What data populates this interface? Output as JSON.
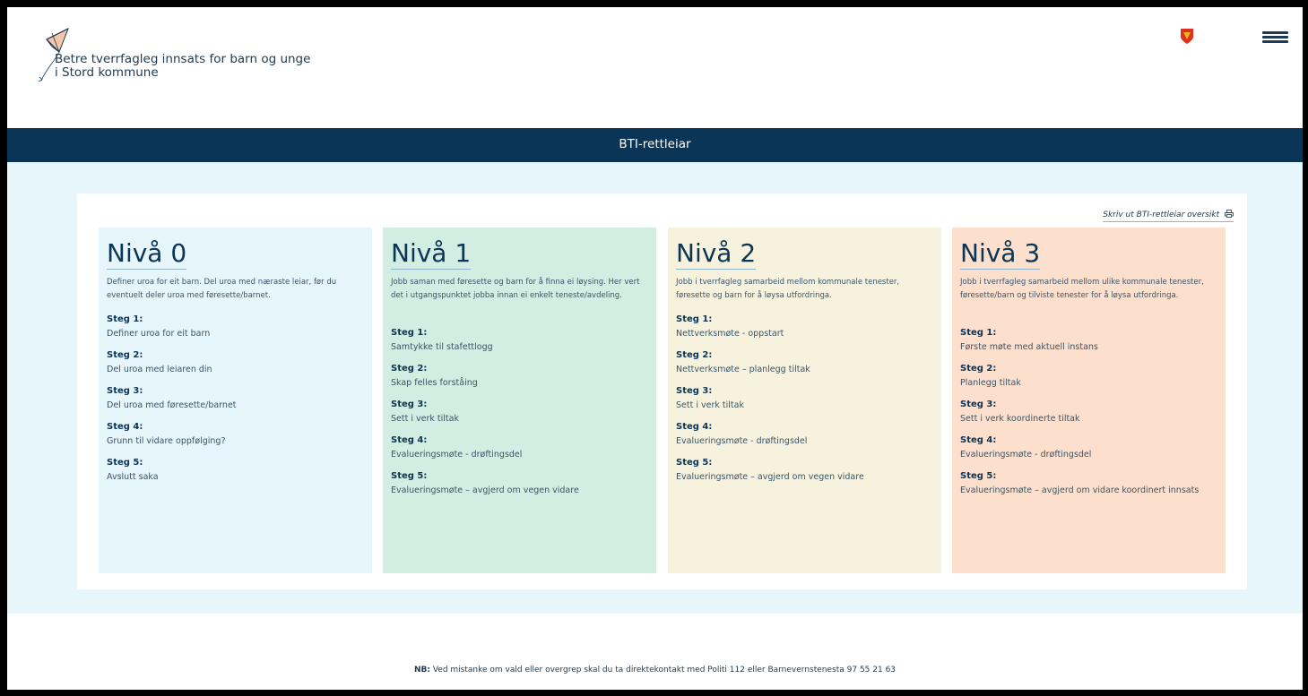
{
  "header": {
    "site_title_line1": "Betre tverrfagleg innsats for barn og unge",
    "site_title_line2": "i Stord kommune",
    "logo_icon": "kite-icon",
    "coat_of_arms_icon": "coat-of-arms-icon",
    "menu_icon": "hamburger-menu-icon"
  },
  "band": {
    "title": "BTI-rettleiar"
  },
  "print_link": {
    "label": "Skriv ut BTI-rettleiar oversikt",
    "icon": "print-icon"
  },
  "levels": [
    {
      "heading": "Nivå 0",
      "description": "Definer uroa for eit barn. Del uroa med næraste leiar, før du eventuelt deler uroa med føresette/barnet.",
      "color": "#e6f6fb",
      "steps": [
        {
          "label": "Steg 1:",
          "text": "Definer uroa for eit barn"
        },
        {
          "label": "Steg 2:",
          "text": "Del uroa med leiaren din"
        },
        {
          "label": "Steg 3:",
          "text": "Del uroa med føresette/barnet"
        },
        {
          "label": "Steg 4:",
          "text": "Grunn til vidare oppfølging?"
        },
        {
          "label": "Steg 5:",
          "text": "Avslutt saka"
        }
      ]
    },
    {
      "heading": "Nivå 1",
      "description": "Jobb saman med føresette og barn for å finna ei løysing. Her vert det i utgangspunktet jobba innan ei enkelt teneste/avdeling.",
      "color": "#d2ede2",
      "steps": [
        {
          "label": "Steg 1:",
          "text": "Samtykke til stafettlogg"
        },
        {
          "label": "Steg 2:",
          "text": "Skap felles forståing"
        },
        {
          "label": "Steg 3:",
          "text": "Sett i verk tiltak"
        },
        {
          "label": "Steg 4:",
          "text": "Evalueringsmøte - drøftingsdel"
        },
        {
          "label": "Steg 5:",
          "text": "Evalueringsmøte – avgjerd om vegen vidare"
        }
      ]
    },
    {
      "heading": "Nivå 2",
      "description": "Jobb i tverrfagleg samarbeid mellom kommunale tenester, føresette og barn for å løysa utfordringa.",
      "color": "#f7f2dd",
      "steps": [
        {
          "label": "Steg 1:",
          "text": "Nettverksmøte - oppstart"
        },
        {
          "label": "Steg 2:",
          "text": "Nettverksmøte – planlegg tiltak"
        },
        {
          "label": "Steg 3:",
          "text": "Sett i verk tiltak"
        },
        {
          "label": "Steg 4:",
          "text": "Evalueringsmøte - drøftingsdel"
        },
        {
          "label": "Steg 5:",
          "text": "Evalueringsmøte – avgjerd om vegen vidare"
        }
      ]
    },
    {
      "heading": "Nivå 3",
      "description": "Jobb i tverrfagleg samarbeid mellom ulike kommunale tenester, føresette/barn og tilviste tenester for å løysa utfordringa.",
      "color": "#fddfcd",
      "steps": [
        {
          "label": "Steg 1:",
          "text": "Første møte med aktuell instans"
        },
        {
          "label": "Steg 2:",
          "text": "Planlegg tiltak"
        },
        {
          "label": "Steg 3:",
          "text": "Sett i verk koordinerte tiltak"
        },
        {
          "label": "Steg 4:",
          "text": "Evalueringsmøte - drøftingsdel"
        },
        {
          "label": "Steg 5:",
          "text": "Evalueringsmøte – avgjerd om vidare koordinert innsats"
        }
      ]
    }
  ],
  "footer": {
    "nb_label": "NB:",
    "note": " Ved mistanke om vald eller overgrep skal du ta direktekontakt med Politi 112 eller Barnevernstenesta 97 55 21 63"
  }
}
